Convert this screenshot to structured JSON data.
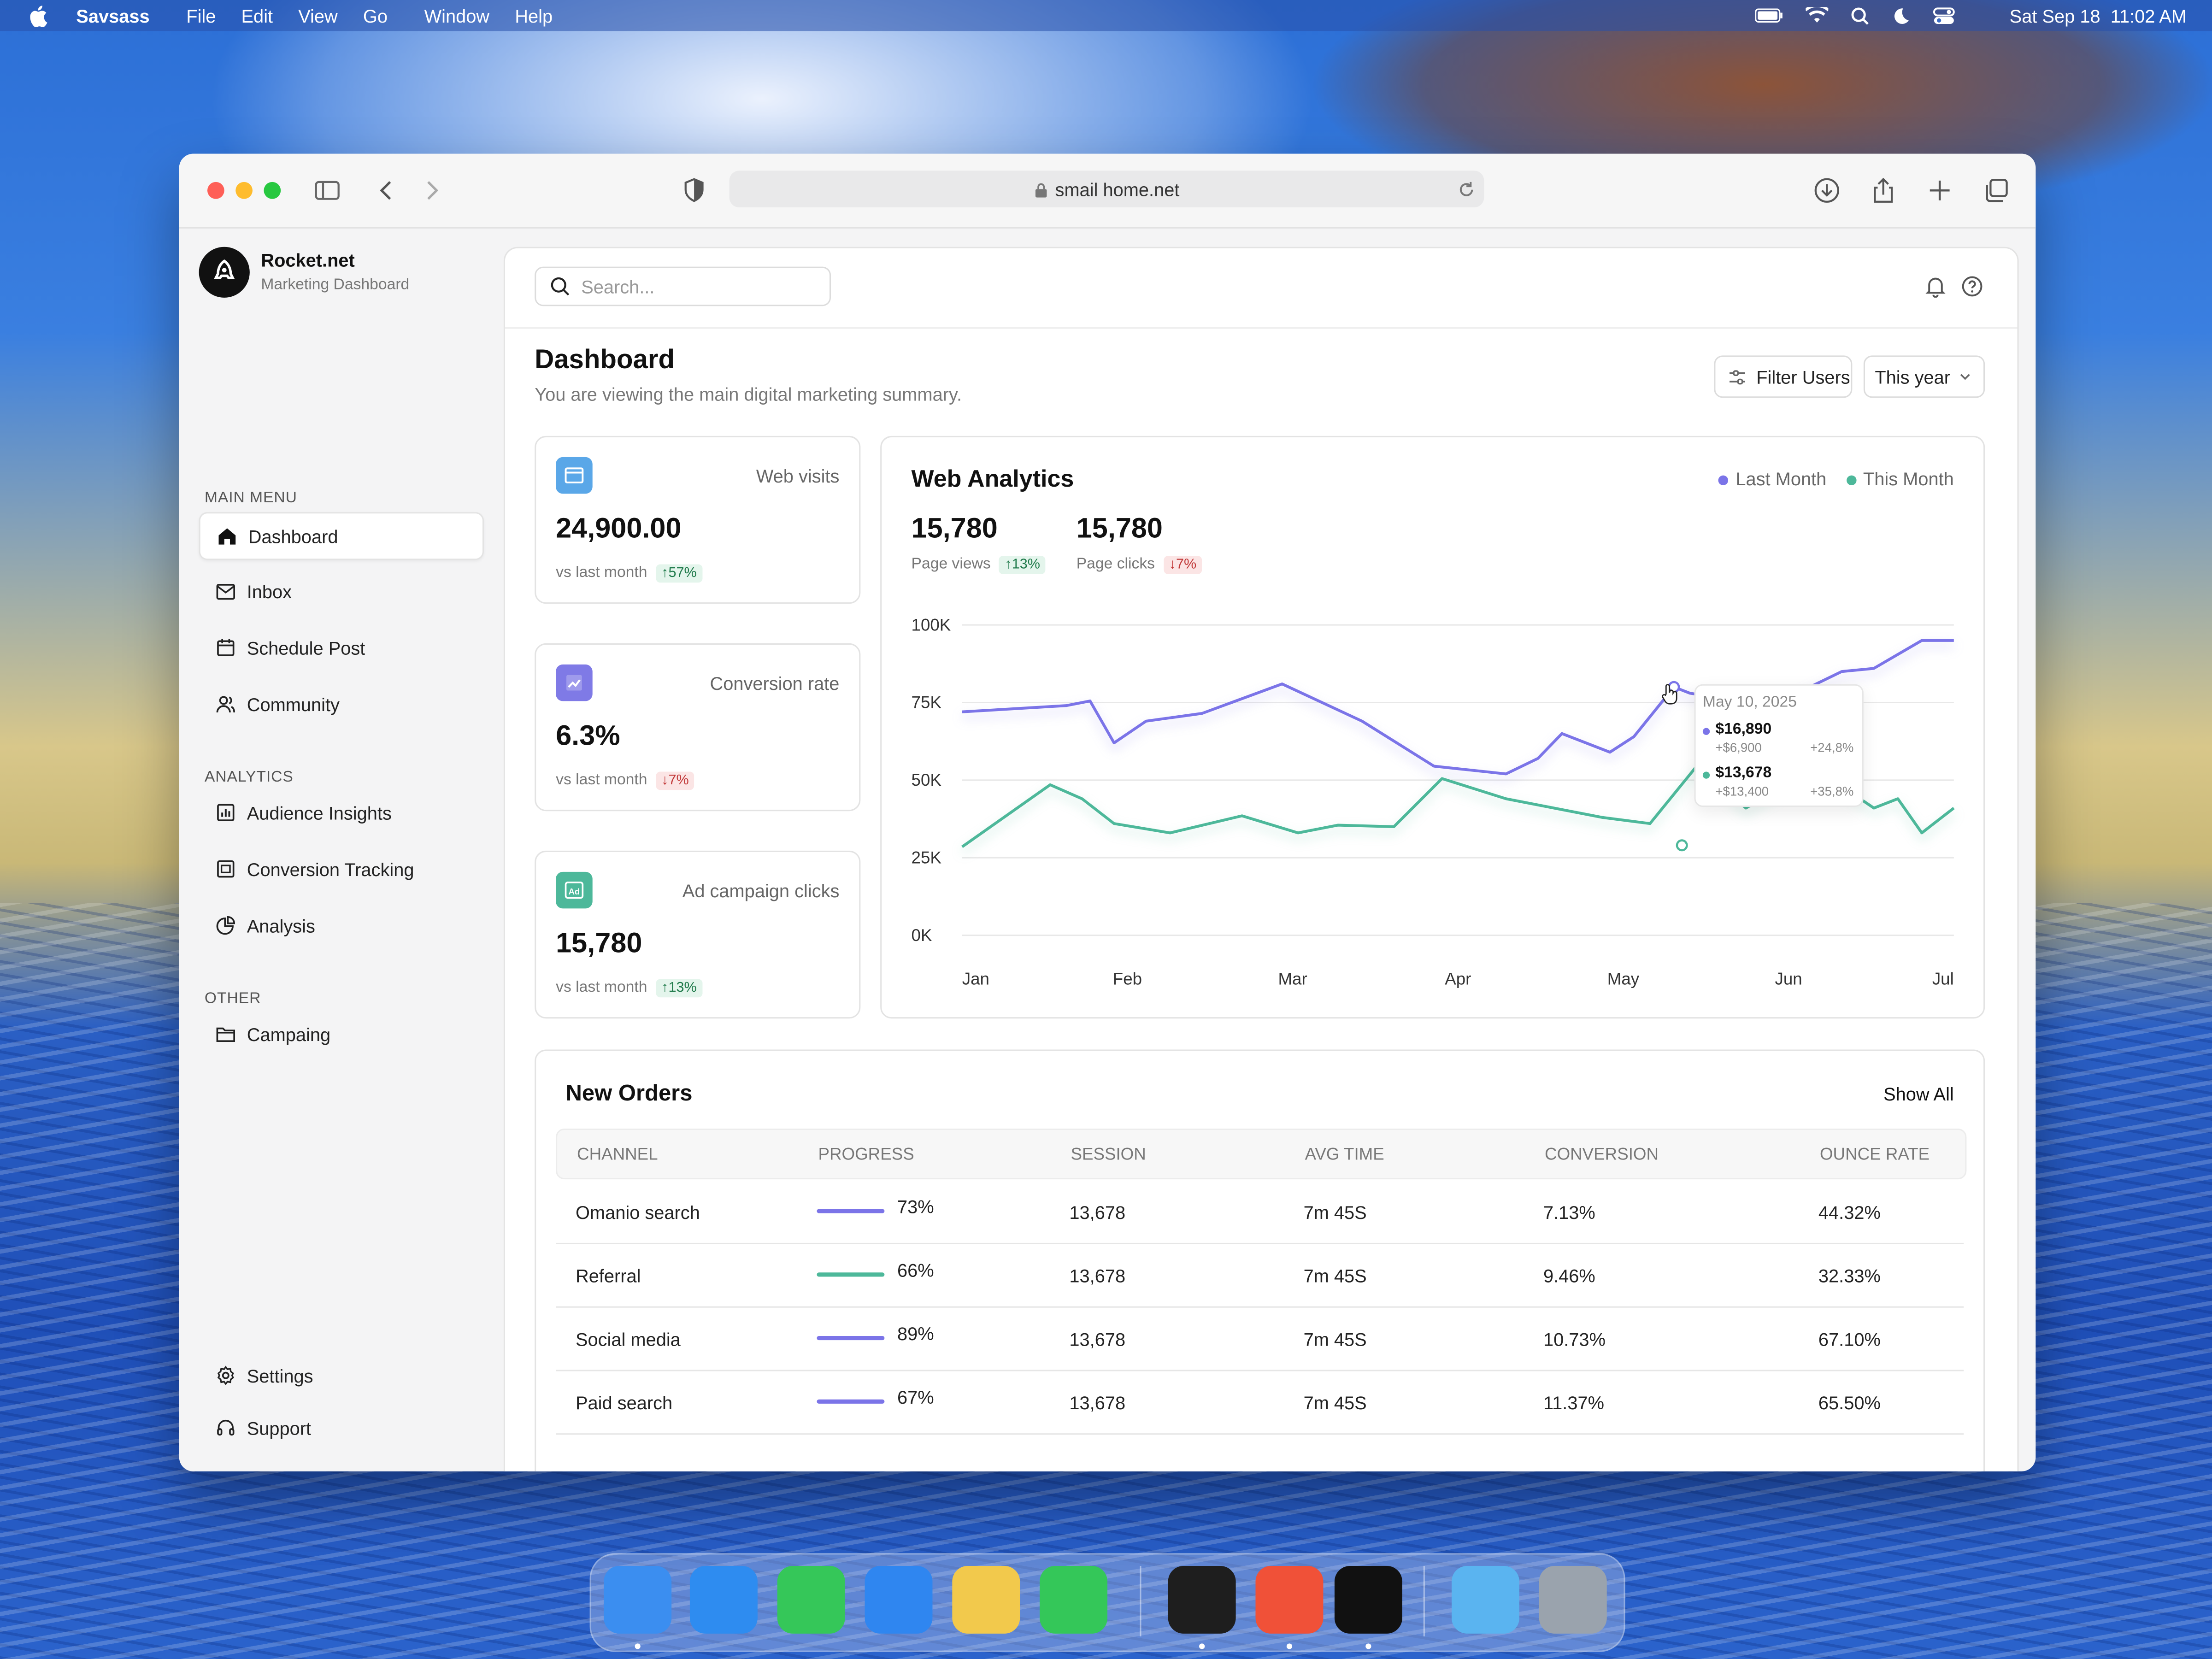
{
  "menubar": {
    "app_name": "Savsass",
    "menus": [
      "File",
      "Edit",
      "View",
      "Go",
      "Window",
      "Help"
    ],
    "datetime": "Sat Sep 18  11:02 AM"
  },
  "browser": {
    "url": "smail home.net"
  },
  "brand": {
    "name": "Rocket.net",
    "subtitle": "Marketing Dashboard"
  },
  "sidebar": {
    "main_label": "MAIN MENU",
    "main_items": [
      "Dashboard",
      "Inbox",
      "Schedule Post",
      "Community"
    ],
    "analytics_label": "ANALYTICS",
    "analytics_items": [
      "Audience Insights",
      "Conversion Tracking",
      "Analysis"
    ],
    "other_label": "OTHER",
    "other_items": [
      "Campaing"
    ],
    "bottom_items": [
      "Settings",
      "Support"
    ]
  },
  "search": {
    "placeholder": "Search..."
  },
  "dashboard": {
    "title": "Dashboard",
    "subtitle": "You are viewing the main digital marketing summary.",
    "filter_label": "Filter Users",
    "period_label": "This year"
  },
  "stats": [
    {
      "label": "Web visits",
      "value": "24,900.00",
      "vs": "vs last month",
      "change": "57%",
      "direction": "up",
      "icon_color": "#5aa7e8"
    },
    {
      "label": "Conversion rate",
      "value": "6.3%",
      "vs": "vs last month",
      "change": "7%",
      "direction": "down",
      "icon_color": "#7f7ae6"
    },
    {
      "label": "Ad campaign clicks",
      "value": "15,780",
      "vs": "vs last month",
      "change": "13%",
      "direction": "up",
      "icon_color": "#4db89a"
    }
  ],
  "analytics": {
    "title": "Web Analytics",
    "legend": [
      "Last Month",
      "This Month"
    ],
    "kpis": [
      {
        "value": "15,780",
        "label": "Page views",
        "change": "13%",
        "direction": "up"
      },
      {
        "value": "15,780",
        "label": "Page clicks",
        "change": "7%",
        "direction": "down"
      }
    ],
    "tooltip": {
      "date": "May 10, 2025",
      "a_value": "$16,890",
      "a_sub": "+$6,900",
      "a_pct": "+24,8%",
      "b_value": "$13,678",
      "b_sub": "+$13,400",
      "b_pct": "+35,8%"
    }
  },
  "chart_data": {
    "type": "line",
    "x_labels": [
      "Jan",
      "Feb",
      "Mar",
      "Apr",
      "May",
      "Jun",
      "Jul"
    ],
    "y_ticks": [
      "100K",
      "75K",
      "50K",
      "25K",
      "0K"
    ],
    "ylim": [
      0,
      100000
    ],
    "series": [
      {
        "name": "Last Month",
        "color": "#7b74e8",
        "x": [
          0,
          0.65,
          0.8,
          0.95,
          1.15,
          1.5,
          2.0,
          2.5,
          2.95,
          3.4,
          3.6,
          3.75,
          4.05,
          4.2,
          4.45,
          4.55,
          4.8,
          5.2,
          5.5,
          5.7,
          6.0,
          6.2
        ],
        "values": [
          72000,
          74000,
          75500,
          62000,
          69000,
          71500,
          81000,
          69000,
          54500,
          52000,
          57000,
          65000,
          59000,
          64000,
          80000,
          78000,
          76000,
          77500,
          85000,
          86000,
          95000,
          95000
        ]
      },
      {
        "name": "This Month",
        "color": "#4db89a",
        "x": [
          0,
          0.55,
          0.75,
          0.95,
          1.3,
          1.75,
          2.1,
          2.35,
          2.7,
          3.0,
          3.4,
          4.0,
          4.3,
          4.6,
          4.9,
          5.2,
          5.5,
          5.7,
          5.85,
          6.0,
          6.2
        ],
        "values": [
          28500,
          48500,
          44000,
          36000,
          33000,
          38500,
          33000,
          35500,
          35000,
          50500,
          44000,
          38000,
          36000,
          55000,
          41000,
          50000,
          48000,
          41000,
          44000,
          33000,
          41000
        ]
      }
    ]
  },
  "orders": {
    "title": "New Orders",
    "show_all": "Show All",
    "columns": [
      "CHANNEL",
      "PROGRESS",
      "SESSION",
      "AVG TIME",
      "CONVERSION",
      "OUNCE RATE"
    ],
    "rows": [
      {
        "channel": "Omanio search",
        "progress": "73%",
        "session": "13,678",
        "avg_time": "7m 45S",
        "conversion": "7.13%",
        "ounce_rate": "44.32%",
        "bar_color": "#7b74e8"
      },
      {
        "channel": "Referral",
        "progress": "66%",
        "session": "13,678",
        "avg_time": "7m 45S",
        "conversion": "9.46%",
        "ounce_rate": "32.33%",
        "bar_color": "#4db89a"
      },
      {
        "channel": "Social media",
        "progress": "89%",
        "session": "13,678",
        "avg_time": "7m 45S",
        "conversion": "10.73%",
        "ounce_rate": "67.10%",
        "bar_color": "#7b74e8"
      },
      {
        "channel": "Paid search",
        "progress": "67%",
        "session": "13,678",
        "avg_time": "7m 45S",
        "conversion": "11.37%",
        "ounce_rate": "65.50%",
        "bar_color": "#7b74e8"
      }
    ]
  },
  "dock": {
    "apps": [
      {
        "name": "finder-icon",
        "color": "#3b8ef0"
      },
      {
        "name": "safari-icon",
        "color": "#2e8cf0"
      },
      {
        "name": "messages-icon",
        "color": "#35c759"
      },
      {
        "name": "mail-icon",
        "color": "#2f86f0"
      },
      {
        "name": "photos-icon",
        "color": "#f2c94c"
      },
      {
        "name": "facetime-icon",
        "color": "#34c759"
      },
      {
        "name": "figma-icon",
        "color": "#1e1e1e"
      },
      {
        "name": "swift-icon",
        "color": "#f05138"
      },
      {
        "name": "rocket-app-icon",
        "color": "#111111"
      },
      {
        "name": "folder-icon",
        "color": "#5ab4f0"
      },
      {
        "name": "trash-icon",
        "color": "#9aa3ad"
      }
    ]
  }
}
